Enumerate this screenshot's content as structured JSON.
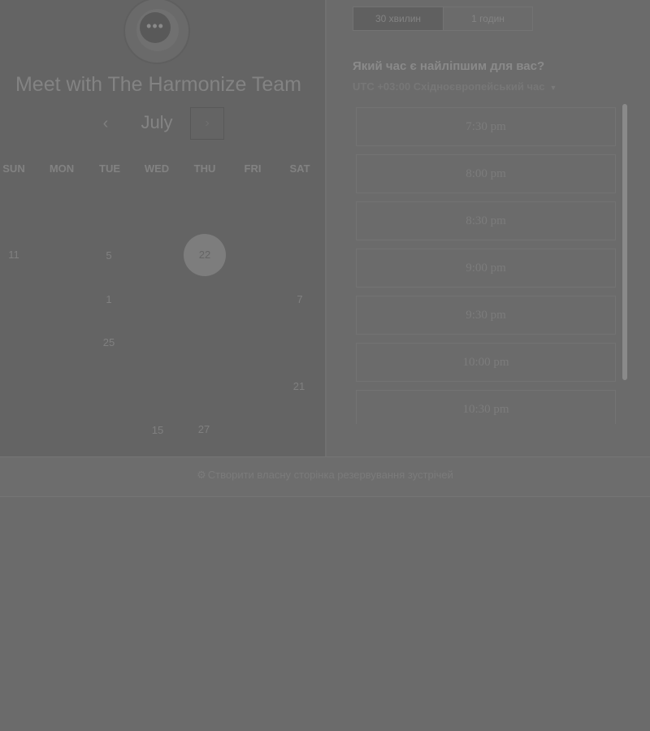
{
  "header": {
    "title": "Meet with The Harmonize Team",
    "avatar_glyph": "•••"
  },
  "calendar": {
    "month": "July",
    "prev_glyph": "‹",
    "next_glyph": "›",
    "weekdays": [
      "SUN",
      "MON",
      "TUE",
      "WED",
      "THU",
      "FRI",
      "SAT"
    ],
    "days": {
      "d11": "11",
      "d5": "5",
      "d22": "22",
      "d1": "1",
      "d7": "7",
      "d25": "25",
      "d21": "21",
      "d15": "15",
      "d27": "27"
    },
    "selected_day": "22"
  },
  "duration": {
    "option1": "30 хвилин",
    "option2": "1 годин"
  },
  "slots_panel": {
    "question": "Який час є найліпшим для вас?",
    "timezone": "UTC +03:00 Східноєвропейський час",
    "times": [
      "7:30 pm",
      "8:00 pm",
      "8:30 pm",
      "9:00 pm",
      "9:30 pm",
      "10:00 pm",
      "10:30 pm"
    ]
  },
  "footer": {
    "link_text": "Створити власну сторінка резервування зустрічей"
  },
  "colors": {
    "overlay_background": "#6b6b6b",
    "panel_background": "#646464"
  },
  "icons": {
    "avatar": "chat-bubble-icon",
    "prev": "chevron-left-icon",
    "next": "chevron-right-icon",
    "timezone_caret": "caret-down-icon",
    "footer": "hubspot-sprocket-icon"
  }
}
